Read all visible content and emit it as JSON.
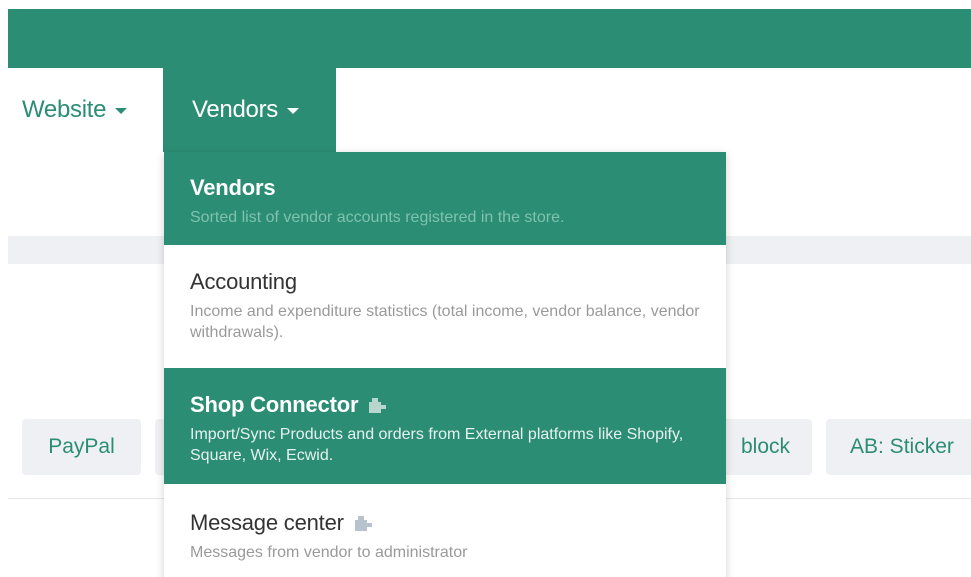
{
  "colors": {
    "brand": "#2b8d74",
    "tab_bg": "#eef0f3",
    "muted_text": "#9a9a9a"
  },
  "nav": {
    "website_label": "Website",
    "vendors_label": "Vendors"
  },
  "tabs": {
    "paypal": "PayPal",
    "block": "block",
    "sticker": "AB: Sticker"
  },
  "dropdown": {
    "items": [
      {
        "title": "Vendors",
        "description": "Sorted list of vendor accounts registered in the store.",
        "active": true,
        "addon": false
      },
      {
        "title": "Accounting",
        "description": "Income and expenditure statistics (total income, vendor balance, vendor withdrawals).",
        "active": false,
        "addon": false
      },
      {
        "title": "Shop Connector",
        "description": "Import/Sync Products and orders from External platforms like Shopify, Square, Wix, Ecwid.",
        "active": true,
        "addon": true,
        "icon": "puzzle-icon"
      },
      {
        "title": "Message center",
        "description": "Messages from vendor to administrator",
        "active": false,
        "addon": true,
        "icon": "puzzle-icon"
      }
    ]
  }
}
